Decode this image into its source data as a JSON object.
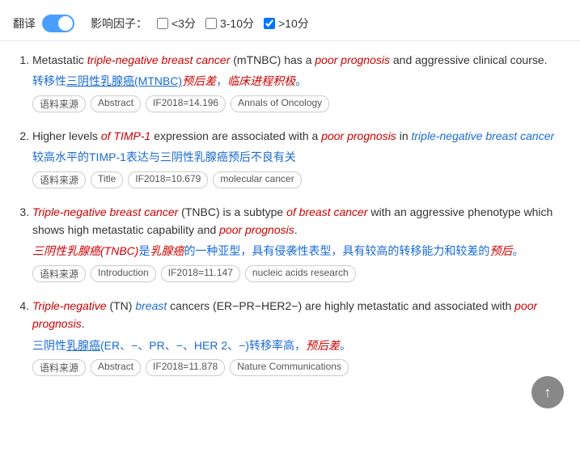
{
  "topbar": {
    "translate_label": "翻译",
    "influence_label": "影响因子：",
    "filters": [
      {
        "id": "lt3",
        "label": "<3分",
        "checked": false
      },
      {
        "id": "3to10",
        "label": "3-10分",
        "checked": false
      },
      {
        "id": "gt10",
        "label": ">10分",
        "checked": true
      }
    ]
  },
  "results": [
    {
      "index": 1,
      "en_parts": [
        {
          "text": "Metastatic ",
          "style": "normal"
        },
        {
          "text": "triple-negative breast cancer",
          "style": "italic-red"
        },
        {
          "text": " (mTNBC) has a ",
          "style": "normal"
        },
        {
          "text": "poor prognosis",
          "style": "italic-red"
        },
        {
          "text": " and aggressive clinical course.",
          "style": "normal"
        }
      ],
      "en_text": "Metastatic triple-negative breast cancer (mTNBC) has a poor prognosis and aggressive clinical course.",
      "zh_text": "转移性三阴性乳腺癌(MTNBC)预后差，临床进程积极。",
      "tags": [
        "语料来源",
        "Abstract",
        "IF2018=14.196",
        "Annals of Oncology"
      ]
    },
    {
      "index": 2,
      "en_text": "Higher levels of TIMP-1 expression are associated with a poor prognosis in triple-negative breast cancer",
      "zh_text": "较高水平的TIMP-1表达与三阴性乳腺癌预后不良有关",
      "tags": [
        "语料来源",
        "Title",
        "IF2018=10.679",
        "molecular cancer"
      ]
    },
    {
      "index": 3,
      "en_text": "Triple-negative breast cancer (TNBC) is a subtype of breast cancer with an aggressive phenotype which shows high metastatic capability and poor prognosis.",
      "zh_text": "三阴性乳腺癌(TNBC)是乳腺癌的一种亚型，具有侵袭性表型，具有较高的转移能力和较差的预后。",
      "tags": [
        "语料来源",
        "Introduction",
        "IF2018=11.147",
        "nucleic acids research"
      ]
    },
    {
      "index": 4,
      "en_text": "Triple-negative (TN) breast cancers (ER−PR−HER2−) are highly metastatic and associated with poor prognosis.",
      "zh_text": "三阴性乳腺癌(ER、−、PR、−、HER 2、−)转移率高，预后差。",
      "tags": [
        "语料来源",
        "Abstract",
        "IF2018=11.878",
        "Nature Communications"
      ]
    }
  ],
  "scroll_top_label": "↑"
}
